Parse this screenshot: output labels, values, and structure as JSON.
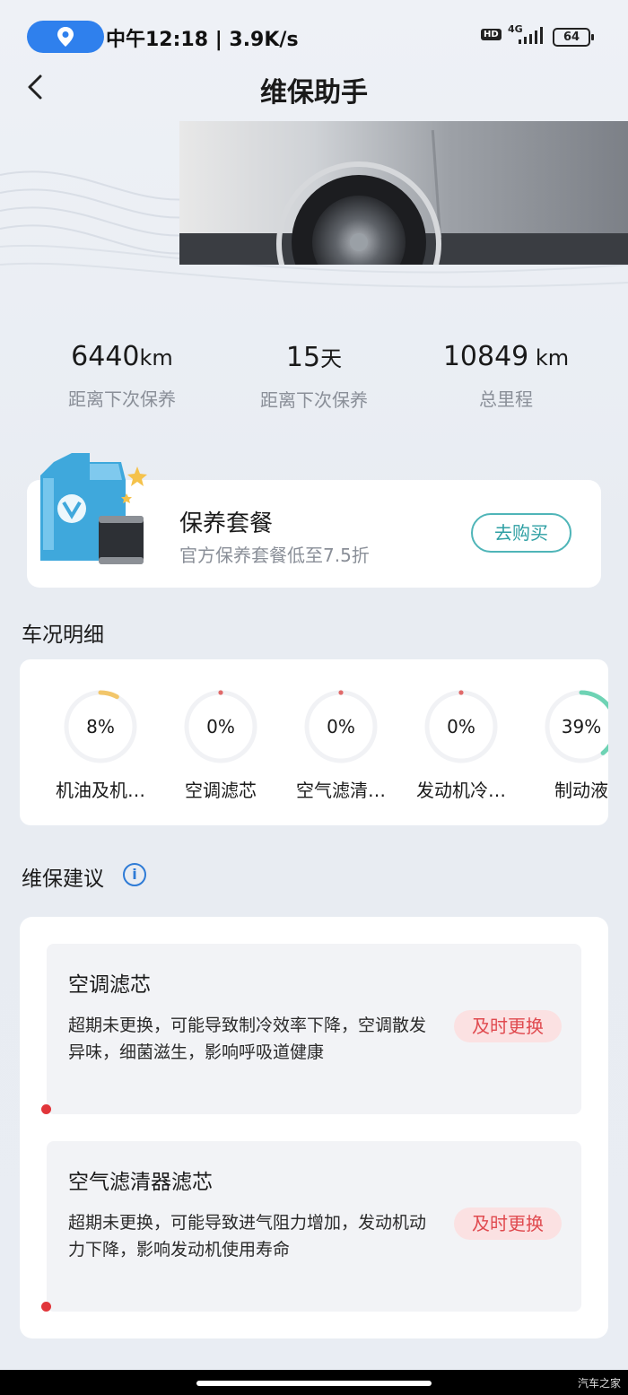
{
  "status_bar": {
    "time": "中午12:18 | 3.9K/s",
    "hd": "HD",
    "network": "4G",
    "battery": "64"
  },
  "header": {
    "title": "维保助手"
  },
  "stats": [
    {
      "value": "6440",
      "unit": "km",
      "label": "距离下次保养"
    },
    {
      "value": "15",
      "unit": "天",
      "label": "距离下次保养"
    },
    {
      "value": "10849",
      "unit": " km",
      "label": "总里程"
    }
  ],
  "package": {
    "title": "保养套餐",
    "subtitle": "官方保养套餐低至7.5折",
    "button": "去购买"
  },
  "condition": {
    "title": "车况明细",
    "items": [
      {
        "percent": "8%",
        "fraction": 0.08,
        "label": "机油及机…",
        "color": "#f2c66a"
      },
      {
        "percent": "0%",
        "fraction": 0,
        "label": "空调滤芯",
        "color": "#e06a6a"
      },
      {
        "percent": "0%",
        "fraction": 0,
        "label": "空气滤清…",
        "color": "#e06a6a"
      },
      {
        "percent": "0%",
        "fraction": 0,
        "label": "发动机冷…",
        "color": "#e06a6a"
      },
      {
        "percent": "39%",
        "fraction": 0.39,
        "label": "制动液",
        "color": "#6ed3b4"
      }
    ]
  },
  "suggestions": {
    "title": "维保建议",
    "items": [
      {
        "title": "空调滤芯",
        "desc": "超期未更换，可能导致制冷效率下降，空调散发异味，细菌滋生，影响呼吸道健康",
        "tag": "及时更换"
      },
      {
        "title": "空气滤清器滤芯",
        "desc": "超期未更换，可能导致进气阻力增加，发动机动力下降，影响发动机使用寿命",
        "tag": "及时更换"
      }
    ]
  },
  "watermark": "汽车之家"
}
